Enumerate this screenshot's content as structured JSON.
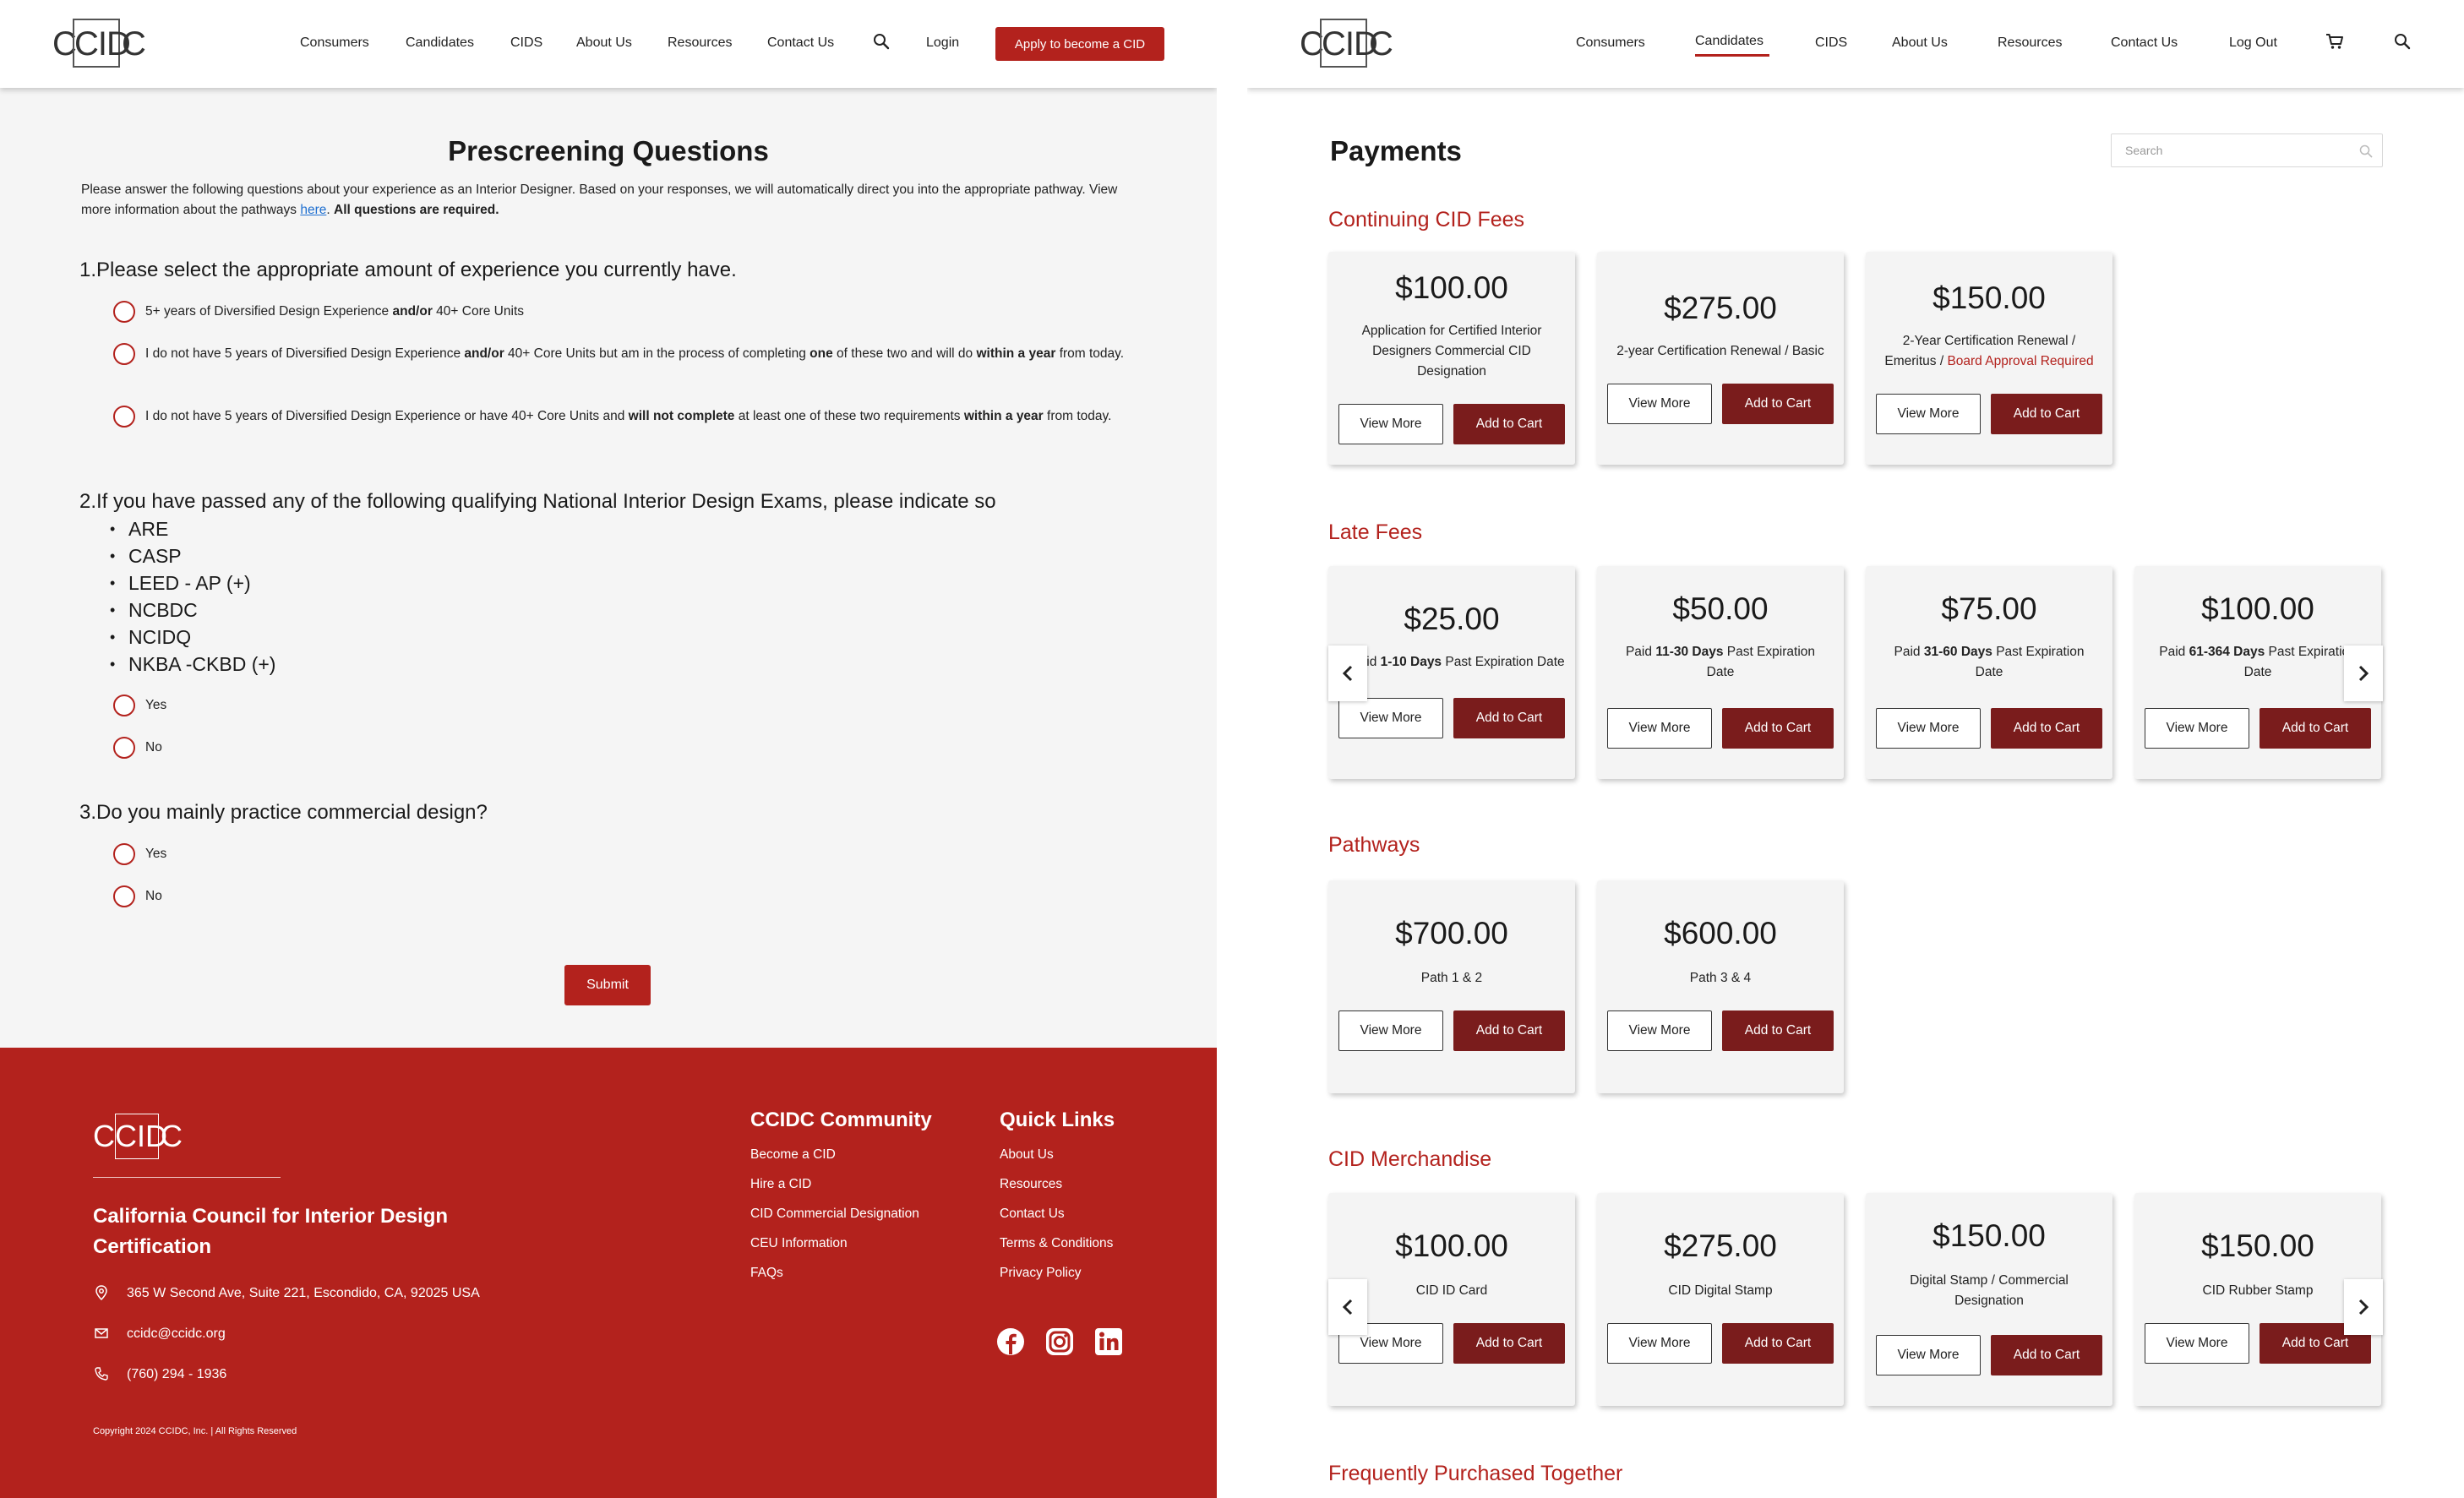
{
  "logo": {
    "left_letter": "C",
    "boxed": "CID",
    "right_letter": "C"
  },
  "left": {
    "nav": {
      "items": [
        "Consumers",
        "Candidates",
        "CIDS",
        "About Us",
        "Resources",
        "Contact Us"
      ],
      "login": "Login",
      "apply": "Apply to become a CID"
    },
    "title": "Prescreening Questions",
    "intro": {
      "text1": "Please answer the following questions about your experience as an Interior Designer. Based on your responses, we will automatically direct you into the appropriate pathway. View more information about the pathways ",
      "link": "here",
      "text2": ". ",
      "bold": "All questions are required."
    },
    "q1": {
      "num": "1.",
      "title": "Please select the appropriate amount of experience you currently have.",
      "opt1": {
        "a": "5+ years of Diversified Design Experience ",
        "b": "and/or",
        "c": " 40+ Core Units"
      },
      "opt2": {
        "a": "I do not have 5 years of Diversified Design Experience ",
        "b": "and/or",
        "c": " 40+ Core Units but am in the process of completing ",
        "d": "one",
        "e": " of these two and will do ",
        "f": "within a year",
        "g": " from today."
      },
      "opt3": {
        "a": "I do not have 5 years of Diversified Design Experience or have 40+ Core Units and ",
        "b": "will not complete",
        "c": " at least one of these two requirements ",
        "d": "within a year",
        "e": " from today."
      }
    },
    "q2": {
      "num": "2.",
      "title": "If you have passed any of the following qualifying National Interior Design Exams, please indicate so",
      "exams": [
        "ARE",
        "CASP",
        "LEED - AP (+)",
        "NCBDC",
        "NCIDQ",
        "NKBA -CKBD (+)"
      ],
      "yes": "Yes",
      "no": "No"
    },
    "q3": {
      "num": "3.",
      "title": "Do you mainly practice commercial design?",
      "yes": "Yes",
      "no": "No"
    },
    "submit": "Submit",
    "footer": {
      "org": "California Council for Interior Design Certification",
      "address": "365 W Second Ave, Suite 221, Escondido, CA, 92025 USA",
      "email": "ccidc@ccidc.org",
      "phone": "(760) 294 - 1936",
      "community_title": "CCIDC Community",
      "community_links": [
        "Become a CID",
        "Hire a CID",
        "CID Commercial Designation",
        "CEU Information",
        "FAQs"
      ],
      "quick_title": "Quick Links",
      "quick_links": [
        "About Us",
        "Resources",
        "Contact Us",
        "Terms & Conditions",
        "Privacy Policy"
      ],
      "copyright": "Copyright 2024 CCIDC, Inc. | All Rights Reserved"
    }
  },
  "right": {
    "nav": {
      "items": [
        "Consumers",
        "Candidates",
        "CIDS",
        "About Us",
        "Resources",
        "Contact Us"
      ],
      "active": "Candidates",
      "logout": "Log Out"
    },
    "title": "Payments",
    "search_placeholder": "Search",
    "buttons": {
      "view": "View More",
      "cart": "Add to Cart"
    },
    "sections": {
      "continuing": {
        "title": "Continuing CID Fees",
        "cards": [
          {
            "price": "$100.00",
            "desc": "Application for Certified Interior Designers Commercial CID Designation"
          },
          {
            "price": "$275.00",
            "desc": "2-year Certification Renewal / Basic"
          },
          {
            "price": "$150.00",
            "desc": "2-Year Certification Renewal / Emeritus / ",
            "desc_highlight": "Board Approval Required"
          }
        ]
      },
      "late": {
        "title": "Late Fees",
        "cards": [
          {
            "price": "$25.00",
            "pre": "Paid ",
            "bold": "1-10 Days",
            "post": " Past Expiration Date"
          },
          {
            "price": "$50.00",
            "pre": "Paid ",
            "bold": "11-30 Days",
            "post": " Past Expiration Date"
          },
          {
            "price": "$75.00",
            "pre": "Paid ",
            "bold": "31-60 Days",
            "post": " Past Expiration Date"
          },
          {
            "price": "$100.00",
            "pre": "Paid ",
            "bold": "61-364 Days",
            "post": " Past Expiration Date"
          }
        ]
      },
      "pathways": {
        "title": "Pathways",
        "cards": [
          {
            "price": "$700.00",
            "desc": "Path 1 & 2"
          },
          {
            "price": "$600.00",
            "desc": "Path 3 & 4"
          }
        ]
      },
      "merch": {
        "title": "CID Merchandise",
        "cards": [
          {
            "price": "$100.00",
            "desc": "CID ID Card"
          },
          {
            "price": "$275.00",
            "desc": "CID Digital Stamp"
          },
          {
            "price": "$150.00",
            "desc": "Digital Stamp / Commercial Designation"
          },
          {
            "price": "$150.00",
            "desc": "CID Rubber Stamp"
          }
        ]
      },
      "frequent": {
        "title": "Frequently Purchased Together"
      }
    }
  },
  "colors": {
    "brand_red": "#b3221d",
    "cart_button": "#7a1c1c",
    "link_blue": "#1e6fd0"
  }
}
